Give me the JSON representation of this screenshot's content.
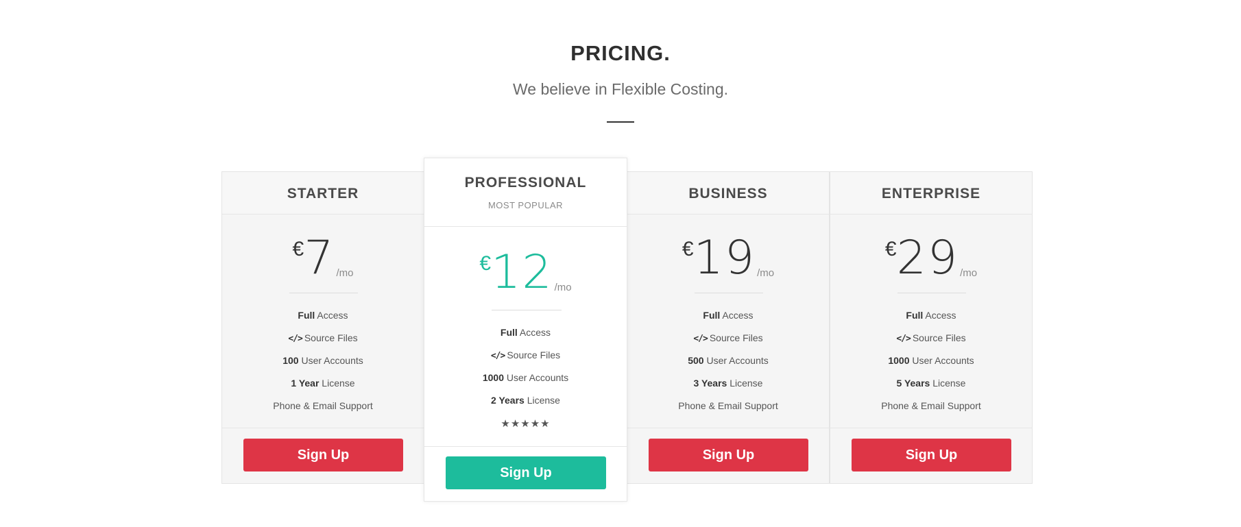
{
  "header": {
    "title": "PRICING.",
    "subtitle": "We believe in Flexible Costing."
  },
  "colors": {
    "accent_green": "#1dbc9c",
    "accent_red": "#de3546"
  },
  "plans": [
    {
      "name": "STARTER",
      "currency": "€",
      "amount": "7",
      "period": "/mo",
      "features": [
        {
          "bold": "Full",
          "text": " Access"
        },
        {
          "icon": "</>",
          "text": "Source Files"
        },
        {
          "bold": "100",
          "text": " User Accounts"
        },
        {
          "bold": "1 Year",
          "text": " License"
        },
        {
          "bold": "",
          "text": "Phone & Email Support"
        }
      ],
      "button": "Sign Up"
    },
    {
      "name": "PROFESSIONAL",
      "tag": "MOST POPULAR",
      "currency": "€",
      "amount": "12",
      "period": "/mo",
      "features": [
        {
          "bold": "Full",
          "text": " Access"
        },
        {
          "icon": "</>",
          "text": "Source Files"
        },
        {
          "bold": "1000",
          "text": " User Accounts"
        },
        {
          "bold": "2 Years",
          "text": " License"
        }
      ],
      "rating": 5,
      "stars": "★★★★★",
      "button": "Sign Up"
    },
    {
      "name": "BUSINESS",
      "currency": "€",
      "amount": "19",
      "period": "/mo",
      "features": [
        {
          "bold": "Full",
          "text": " Access"
        },
        {
          "icon": "</>",
          "text": "Source Files"
        },
        {
          "bold": "500",
          "text": " User Accounts"
        },
        {
          "bold": "3 Years",
          "text": " License"
        },
        {
          "bold": "",
          "text": "Phone & Email Support"
        }
      ],
      "button": "Sign Up"
    },
    {
      "name": "ENTERPRISE",
      "currency": "€",
      "amount": "29",
      "period": "/mo",
      "features": [
        {
          "bold": "Full",
          "text": " Access"
        },
        {
          "icon": "</>",
          "text": "Source Files"
        },
        {
          "bold": "1000",
          "text": " User Accounts"
        },
        {
          "bold": "5 Years",
          "text": " License"
        },
        {
          "bold": "",
          "text": "Phone & Email Support"
        }
      ],
      "button": "Sign Up"
    }
  ]
}
